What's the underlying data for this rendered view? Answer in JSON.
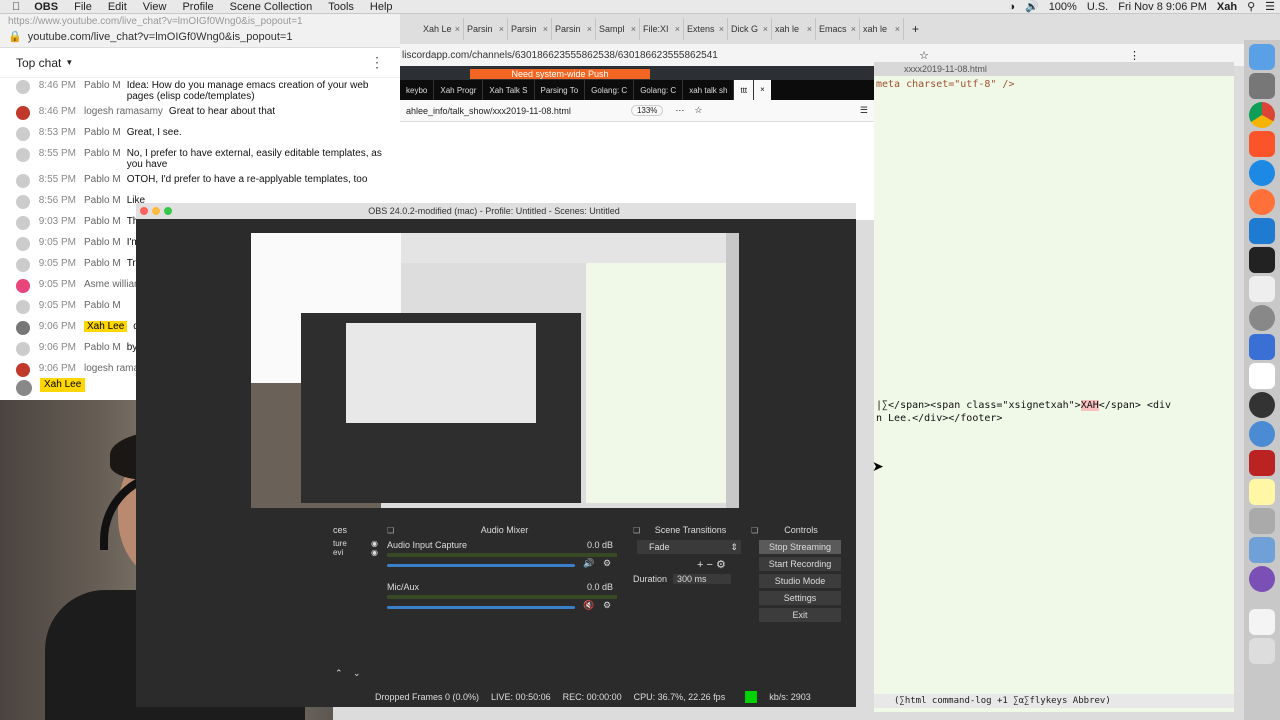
{
  "menubar": {
    "app_name": "OBS",
    "items": [
      "File",
      "Edit",
      "View",
      "Profile",
      "Scene Collection",
      "Tools",
      "Help"
    ],
    "battery": "100%",
    "locale": "U.S.",
    "clock": "Fri Nov 8  9:06 PM",
    "user": "Xah"
  },
  "chat": {
    "url_gray": "https://www.youtube.com/live_chat?v=lmOIGf0Wng0&is_popout=1",
    "url_main": "youtube.com/live_chat?v=lmOIGf0Wng0&is_popout=1",
    "header": "Top chat",
    "messages": [
      {
        "time": "8:46 PM",
        "author": "Pablo M",
        "text": "Idea: How do you manage emacs creation of your web pages (elisp code/templates)",
        "avatar": "#cccccc",
        "hl": false
      },
      {
        "time": "8:46 PM",
        "author": "logesh ramasamy",
        "text": "Great to hear about that",
        "avatar": "#c0392b",
        "hl": false
      },
      {
        "time": "8:53 PM",
        "author": "Pablo M",
        "text": "Great, I see.",
        "avatar": "#cccccc",
        "hl": false
      },
      {
        "time": "8:55 PM",
        "author": "Pablo M",
        "text": "No, I prefer to have external, easily editable templates, as you have",
        "avatar": "#cccccc",
        "hl": false
      },
      {
        "time": "8:55 PM",
        "author": "Pablo M",
        "text": "OTOH, I'd prefer to have a re-applyable templates, too",
        "avatar": "#cccccc",
        "hl": false
      },
      {
        "time": "8:56 PM",
        "author": "Pablo M",
        "text": "Like",
        "avatar": "#cccccc",
        "hl": false
      },
      {
        "time": "9:03 PM",
        "author": "Pablo M",
        "text": "That",
        "avatar": "#cccccc",
        "hl": false
      },
      {
        "time": "9:05 PM",
        "author": "Pablo M",
        "text": "I'm",
        "avatar": "#cccccc",
        "hl": false
      },
      {
        "time": "9:05 PM",
        "author": "Pablo M",
        "text": "Try",
        "avatar": "#cccccc",
        "hl": false
      },
      {
        "time": "9:05 PM",
        "author": "Asme william",
        "text": "",
        "avatar": "#e8457a",
        "hl": false
      },
      {
        "time": "9:05 PM",
        "author": "Pablo M",
        "text": "",
        "avatar": "#cccccc",
        "hl": false
      },
      {
        "time": "9:06 PM",
        "author": "Xah Lee",
        "text": "d",
        "avatar": "#777777",
        "hl": true
      },
      {
        "time": "9:06 PM",
        "author": "Pablo M",
        "text": "bye",
        "avatar": "#cccccc",
        "hl": false
      },
      {
        "time": "9:06 PM",
        "author": "logesh ramas",
        "text": "",
        "avatar": "#c0392b",
        "hl": false
      }
    ],
    "input_tag": "Xah Lee"
  },
  "browser": {
    "tabs": [
      "Xah Le",
      "Parsin",
      "Parsin",
      "Parsin",
      "Sampl",
      "File:XI",
      "Extens",
      "Dick G",
      "xah le",
      "Emacs",
      "xah le"
    ],
    "address": "liscordapp.com/channels/630186623555862538/630186623555862541"
  },
  "discord": {
    "banner": "Need system-wide Push"
  },
  "firefox": {
    "tabs": [
      "keybo",
      "Xah Progr",
      "Xah Talk S",
      "Parsing To",
      "Golang: C",
      "Golang: C",
      "xah talk sh",
      "ttt"
    ],
    "active_tab": "ttt",
    "url": "ahlee_info/talk_show/xxx2019-11-08.html",
    "zoom": "133%"
  },
  "editor": {
    "title": "xxxx2019-11-08.html",
    "line1": "meta charset=\"utf-8\" />",
    "line2_a": "∣∑</span><span class=\"xsignetxah\">",
    "line2_hl": "XAH",
    "line2_b": "</span> <div",
    "line3": "n Lee.</div></footer>",
    "modeline": "(∑html command-log +1 ∑α∑flykeys Abbrev)"
  },
  "obs": {
    "title": "OBS 24.0.2-modified (mac) - Profile: Untitled - Scenes: Untitled",
    "sources_head": "ces",
    "sources": [
      "ture",
      "evi"
    ],
    "mixer_head": "Audio Mixer",
    "mixer": [
      {
        "name": "Audio Input Capture",
        "db": "0.0 dB",
        "muted": false
      },
      {
        "name": "Mic/Aux",
        "db": "0.0 dB",
        "muted": true
      }
    ],
    "transitions_head": "Scene Transitions",
    "transition": "Fade",
    "duration_label": "Duration",
    "duration": "300 ms",
    "controls_head": "Controls",
    "controls": [
      "Stop Streaming",
      "Start Recording",
      "Studio Mode",
      "Settings",
      "Exit"
    ],
    "status": {
      "dropped": "Dropped Frames 0 (0.0%)",
      "live": "LIVE: 00:50:06",
      "rec": "REC: 00:00:00",
      "cpu": "CPU: 36.7%, 22.26 fps",
      "kbs": "kb/s: 2903"
    }
  }
}
